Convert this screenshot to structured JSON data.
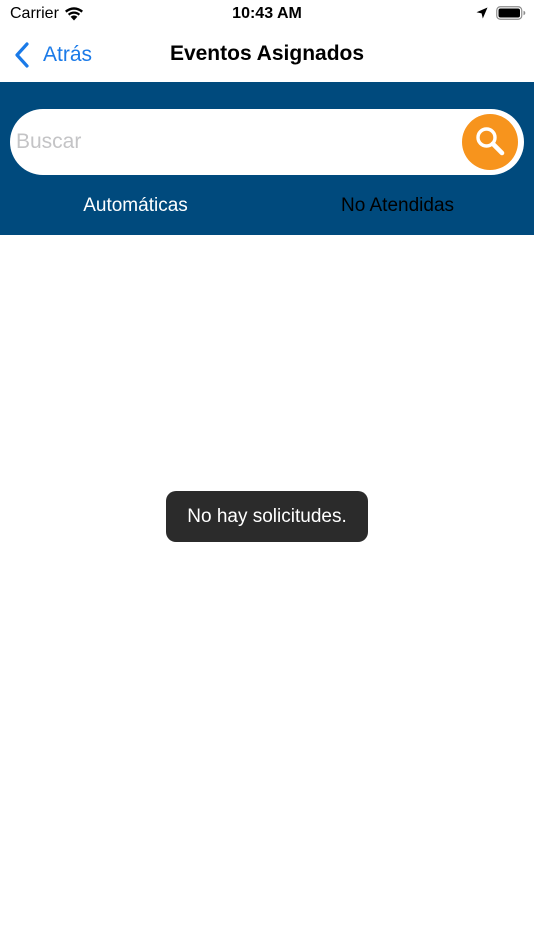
{
  "status_bar": {
    "carrier": "Carrier",
    "time": "10:43 AM",
    "icons": [
      "wifi-icon",
      "location-icon",
      "battery-icon"
    ]
  },
  "nav": {
    "back_label": "Atrás",
    "back_icon": "chevron-left-icon",
    "title": "Eventos Asignados"
  },
  "search": {
    "placeholder": "Buscar",
    "value": "",
    "button_icon": "search-icon"
  },
  "tabs": [
    {
      "label": "Automáticas",
      "selected": true
    },
    {
      "label": "No Atendidas",
      "selected": false
    }
  ],
  "toast": {
    "message": "No hay solicitudes."
  },
  "colors": {
    "header_blue": "#004a7d",
    "accent_orange": "#f7941d",
    "link_blue": "#1a7ae8",
    "toast_bg": "#2b2b2b"
  }
}
